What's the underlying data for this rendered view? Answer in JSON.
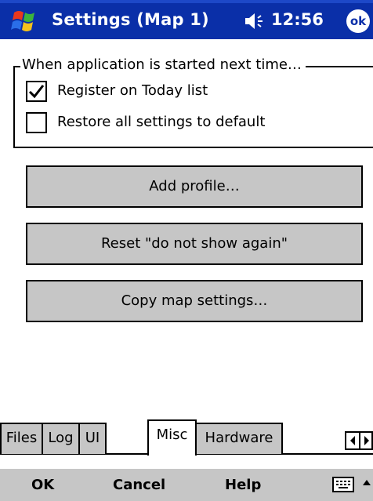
{
  "titlebar": {
    "title": "Settings (Map 1)",
    "time": "12:56",
    "ok_label": "ok",
    "start_icon": "windows-flag-icon",
    "volume_icon": "speaker-icon",
    "bg_color": "#0a2fa8"
  },
  "group": {
    "legend": "When application is started next time…",
    "items": [
      {
        "label": "Register on Today list",
        "checked": true
      },
      {
        "label": "Restore all settings to default",
        "checked": false
      }
    ]
  },
  "buttons": {
    "add_profile": "Add profile…",
    "reset_dont_show": "Reset \"do not show again\"",
    "copy_map_settings": "Copy map settings…"
  },
  "tabs": [
    {
      "label": "Files",
      "active": false
    },
    {
      "label": "Log",
      "active": false
    },
    {
      "label": "UI",
      "active": false
    },
    {
      "label": "Misc",
      "active": true
    },
    {
      "label": "Hardware",
      "active": false
    }
  ],
  "tab_scroll_icons": [
    "arrow-left-icon",
    "arrow-right-icon"
  ],
  "menubar": {
    "ok": "OK",
    "cancel": "Cancel",
    "help": "Help",
    "keyboard_icon": "keyboard-icon",
    "sip_icon": "arrow-up-icon"
  }
}
